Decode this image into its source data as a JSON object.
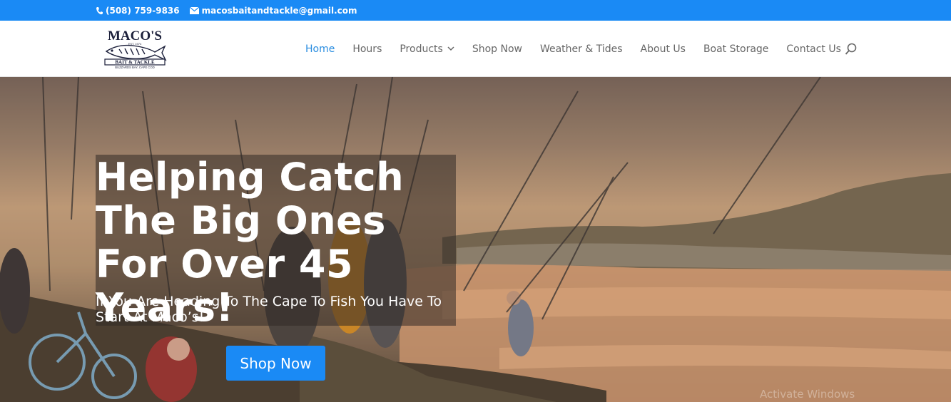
{
  "topbar": {
    "phone": "(508) 759-9836",
    "email": "macosbaitandtackle@gmail.com",
    "background": "#1a8af5"
  },
  "logo": {
    "name": "MACO'S",
    "tagline": "BAIT & TACKLE",
    "location": "BUZZARDS BAY, CAPE COD",
    "year": "EST. 1974"
  },
  "nav": {
    "items": [
      {
        "label": "Home",
        "active": true
      },
      {
        "label": "Hours"
      },
      {
        "label": "Products",
        "has_dropdown": true
      },
      {
        "label": "Shop Now"
      },
      {
        "label": "Weather & Tides"
      },
      {
        "label": "About Us"
      },
      {
        "label": "Boat Storage"
      },
      {
        "label": "Contact Us"
      }
    ],
    "accent": "#2a8de0"
  },
  "hero": {
    "headline": "Helping Catch The Big Ones For Over 45 Years!",
    "subheadline": "If You Are Heading To The Cape To Fish You Have To Start At Maco’s!",
    "cta_label": "Shop Now",
    "watermark": "Activate Windows"
  }
}
